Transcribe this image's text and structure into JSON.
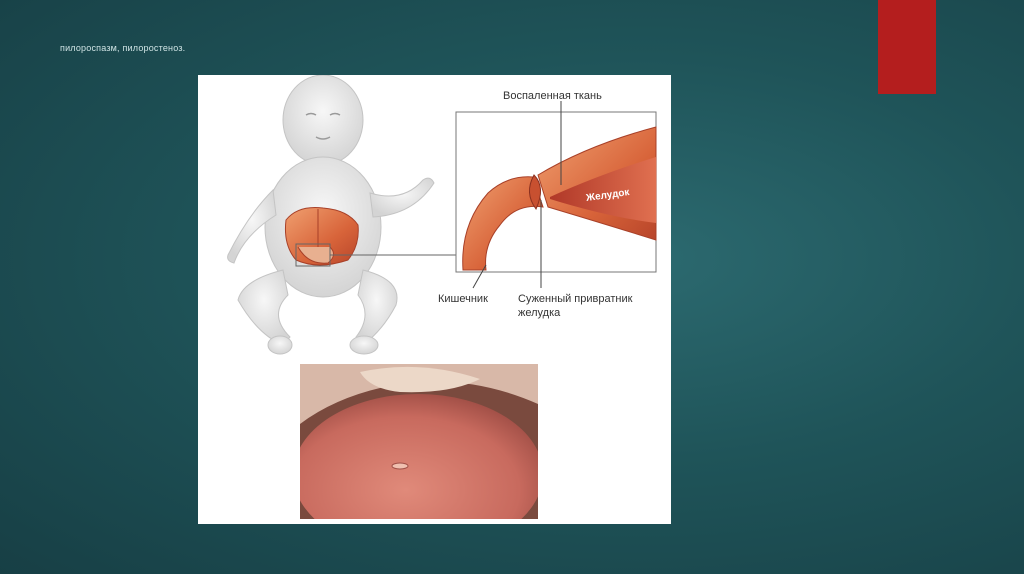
{
  "slide": {
    "title": "пилороспазм, пилоростеноз.",
    "accent_color": "#b41e1e",
    "background_color": "#1f5459"
  },
  "figure": {
    "labels": {
      "inflamed_tissue": "Воспаленная ткань",
      "stomach": "Желудок",
      "intestine": "Кишечник",
      "narrowed_pylorus_line1": "Суженный привратник",
      "narrowed_pylorus_line2": "желудка"
    }
  }
}
